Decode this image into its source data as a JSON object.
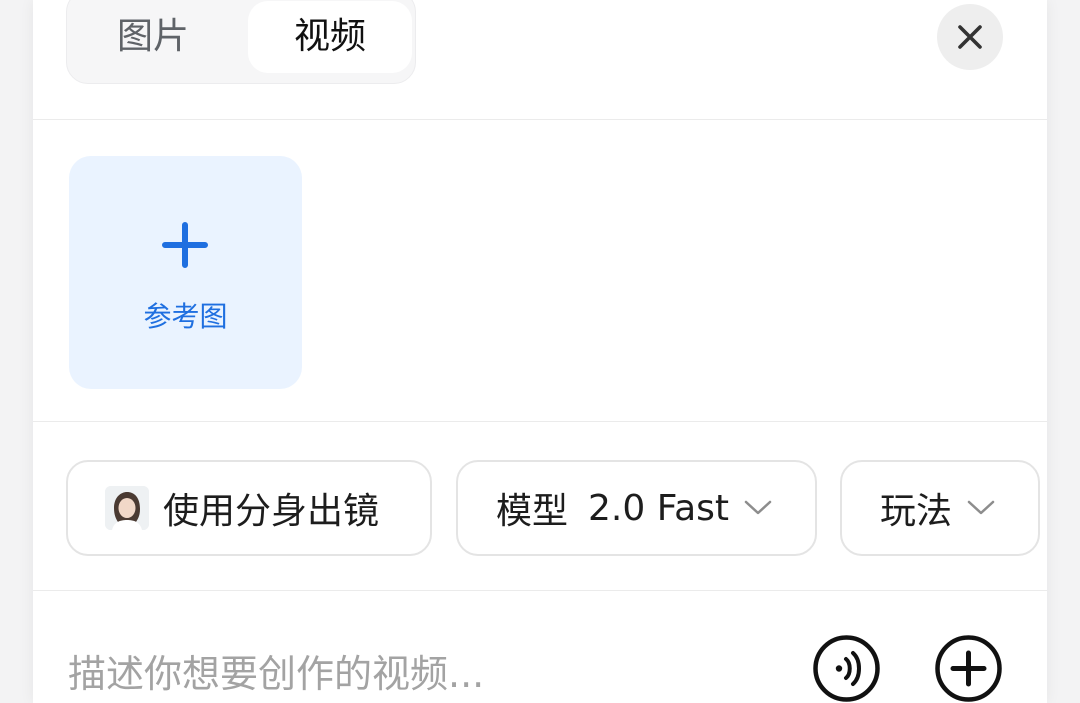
{
  "tabs": {
    "image": "图片",
    "video": "视频"
  },
  "reference": {
    "label": "参考图"
  },
  "chips": {
    "avatar": "使用分身出镜",
    "model_label": "模型",
    "model_value": "2.0 Fast",
    "play": "玩法"
  },
  "input": {
    "placeholder": "描述你想要创作的视频..."
  },
  "icons": {
    "close": "close-icon",
    "plus": "plus-icon",
    "voice": "voice-icon",
    "add": "add-circle-icon",
    "chevron": "chevron-down-icon"
  },
  "colors": {
    "accent": "#1f6fe0",
    "reference_bg": "#eaf3ff",
    "placeholder": "#a3a3a3"
  }
}
